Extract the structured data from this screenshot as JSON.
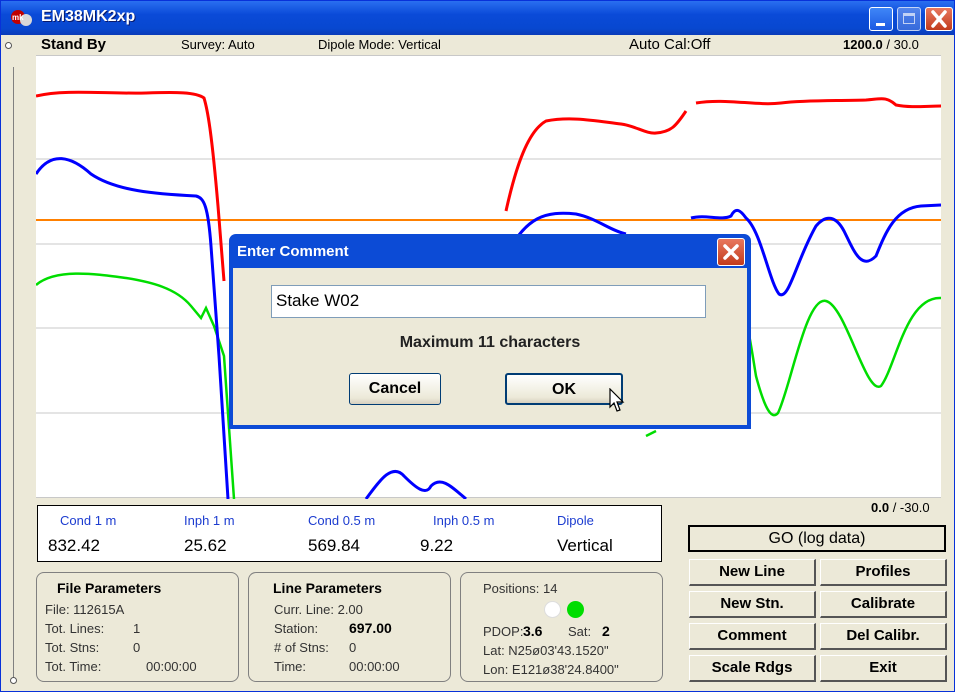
{
  "window": {
    "title": "EM38MK2xp"
  },
  "status_bar": {
    "state": "Stand By",
    "survey": "Survey: Auto",
    "dipole_mode": "Dipole Mode: Vertical",
    "auto_cal": "Auto Cal:Off",
    "scale_top_value": "1200.0",
    "scale_top_rest": " / 30.0"
  },
  "plot": {
    "scale_bottom_value": "0.0",
    "scale_bottom_rest": " / -30.0",
    "series_colors": {
      "cond_1m": "#ff0000",
      "inph_1m": "#0000ff",
      "cond_05m": "#00dd00",
      "reference": "#ff8000"
    }
  },
  "readings": {
    "labels": [
      "Cond 1 m",
      "Inph 1 m",
      "Cond 0.5 m",
      "Inph 0.5 m",
      "Dipole"
    ],
    "values": [
      "832.42",
      "25.62",
      "569.84",
      "9.22",
      "Vertical"
    ]
  },
  "file_params": {
    "title": "File Parameters",
    "file": "File: 112615A",
    "tot_lines_label": "Tot. Lines:",
    "tot_lines": "1",
    "tot_stns_label": "Tot. Stns:",
    "tot_stns": "0",
    "tot_time_label": "Tot. Time:",
    "tot_time": "00:00:00"
  },
  "line_params": {
    "title": "Line Parameters",
    "curr_line": "Curr. Line: 2.00",
    "station_label": "Station:",
    "station": "697.00",
    "num_stns_label": "# of Stns:",
    "num_stns": "0",
    "time_label": "Time:",
    "time": "00:00:00"
  },
  "gps": {
    "positions": "Positions: 14",
    "pdop_label": "PDOP:",
    "pdop": "3.6",
    "sat_label": "Sat:",
    "sat": "2",
    "lat": "Lat:  N25ø03'43.1520\"",
    "lon": "Lon: E121ø38'24.8400\""
  },
  "buttons": {
    "go": "GO (log data)",
    "new_line": "New Line",
    "profiles": "Profiles",
    "new_stn": "New Stn.",
    "calibrate": "Calibrate",
    "comment": "Comment",
    "del_calibr": "Del Calibr.",
    "scale_rdgs": "Scale Rdgs",
    "exit": "Exit"
  },
  "dialog": {
    "title": "Enter Comment",
    "input_value": "Stake W02",
    "message": "Maximum 11 characters",
    "cancel": "Cancel",
    "ok": "OK"
  }
}
